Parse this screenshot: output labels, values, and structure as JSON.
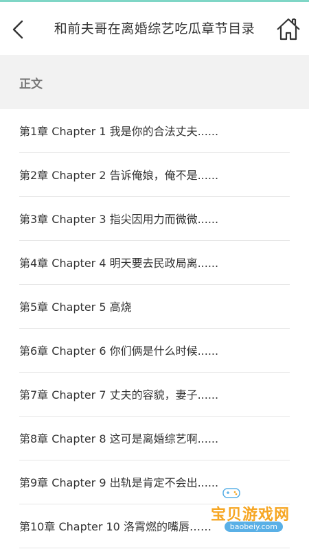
{
  "header": {
    "title": "和前夫哥在离婚综艺吃瓜章节目录"
  },
  "section": {
    "label": "正文"
  },
  "chapters": [
    "第1章 Chapter 1 我是你的合法丈夫......",
    "第2章 Chapter 2 告诉俺娘，俺不是......",
    "第3章 Chapter 3 指尖因用力而微微......",
    "第4章 Chapter 4 明天要去民政局离......",
    "第5章 Chapter 5 高烧",
    "第6章 Chapter 6 你们俩是什么时候......",
    "第7章 Chapter 7 丈夫的容貌，妻子......",
    "第8章 Chapter 8 这可是离婚综艺啊......",
    "第9章 Chapter 9 出轨是肯定不会出......",
    "第10章 Chapter 10 洛霄燃的嘴唇……"
  ],
  "watermark": {
    "text": "宝贝游戏网",
    "url": "baobeiy.com"
  },
  "colors": {
    "accent": "#7fd6c6",
    "section_bg": "#f2f2f2",
    "watermark": "#f6a623"
  }
}
